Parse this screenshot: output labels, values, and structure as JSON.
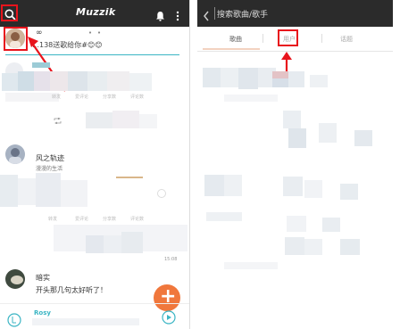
{
  "left": {
    "app_title": "Muzzik",
    "feed": [
      {
        "avatar_alt": "user avatar",
        "name": "∞",
        "text": "…138送歌给你#😊😊"
      },
      {
        "name": "风之轨迹",
        "subtext": "漫漫的生活"
      },
      {
        "name": "暗实",
        "text": "开头那几句太好听了！"
      },
      {
        "name": "Rosy"
      }
    ],
    "action_labels": [
      "转发",
      "爱评论",
      "分享数",
      "评论数"
    ],
    "timestamp": "15:08",
    "fab_label": "+"
  },
  "right": {
    "search_placeholder": "搜索歌曲/歌手",
    "tabs": [
      {
        "label": "歌曲",
        "active": true
      },
      {
        "label": "用户",
        "active": false
      },
      {
        "label": "话题",
        "active": false
      }
    ]
  },
  "colors": {
    "topbar": "#2b2b2b",
    "highlight": "#e8141c",
    "accent": "#f0773c",
    "teal": "#3bb5c4"
  }
}
